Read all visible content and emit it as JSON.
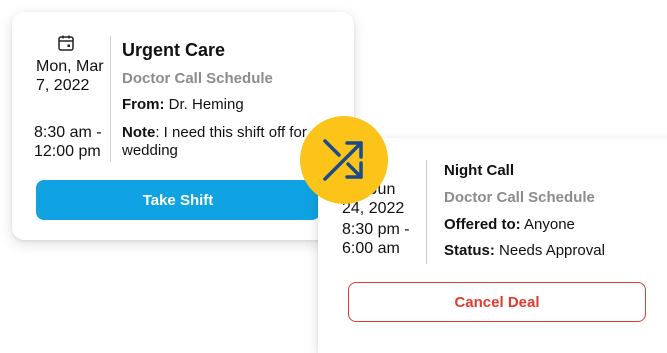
{
  "offer_card": {
    "date_line1": "Mon, Mar",
    "date_line2": "7, 2022",
    "time_line1": "8:30 am -",
    "time_line2": "12:00 pm",
    "title": "Urgent Care",
    "subtitle": "Doctor Call Schedule",
    "from_label": "From:",
    "from_value": "Dr. Heming",
    "note_label": "Note",
    "note_value": ": I need this shift off for wedding",
    "take_button": "Take Shift",
    "icon": "calendar-icon"
  },
  "deal_card": {
    "date_line1": "Fri, Jun",
    "date_line2": "24, 2022",
    "time_line1": "8:30 pm -",
    "time_line2": "6:00 am",
    "title": "Night Call",
    "subtitle": "Doctor Call Schedule",
    "offered_label": "Offered to:",
    "offered_value": "Anyone",
    "status_label": "Status:",
    "status_value": "Needs Approval",
    "cancel_button": "Cancel Deal",
    "icon": "calendar-icon"
  },
  "swap_badge": {
    "icon": "shuffle-icon"
  },
  "colors": {
    "take_button": "#10a3e3",
    "cancel_border": "#e03b2e",
    "swap_badge": "#fcc418",
    "shuffle_arrows": "#1a4a8a"
  }
}
